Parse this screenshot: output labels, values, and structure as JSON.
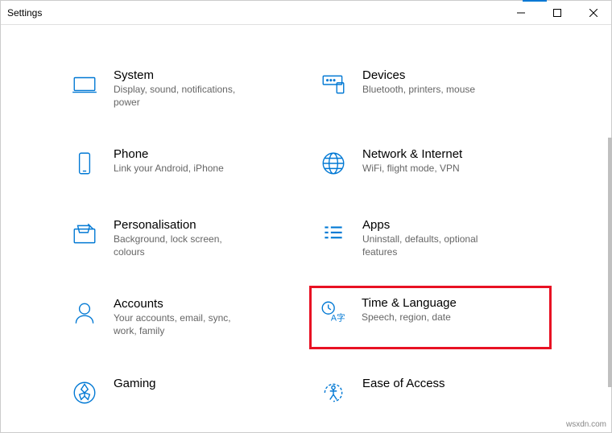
{
  "window": {
    "title": "Settings"
  },
  "categories": [
    {
      "key": "system",
      "title": "System",
      "desc": "Display, sound, notifications, power"
    },
    {
      "key": "devices",
      "title": "Devices",
      "desc": "Bluetooth, printers, mouse"
    },
    {
      "key": "phone",
      "title": "Phone",
      "desc": "Link your Android, iPhone"
    },
    {
      "key": "network",
      "title": "Network & Internet",
      "desc": "WiFi, flight mode, VPN"
    },
    {
      "key": "personalisation",
      "title": "Personalisation",
      "desc": "Background, lock screen, colours"
    },
    {
      "key": "apps",
      "title": "Apps",
      "desc": "Uninstall, defaults, optional features"
    },
    {
      "key": "accounts",
      "title": "Accounts",
      "desc": "Your accounts, email, sync, work, family"
    },
    {
      "key": "time-language",
      "title": "Time & Language",
      "desc": "Speech, region, date",
      "highlight": true
    },
    {
      "key": "gaming",
      "title": "Gaming",
      "desc": ""
    },
    {
      "key": "ease-of-access",
      "title": "Ease of Access",
      "desc": ""
    }
  ],
  "watermark": "wsxdn.com"
}
